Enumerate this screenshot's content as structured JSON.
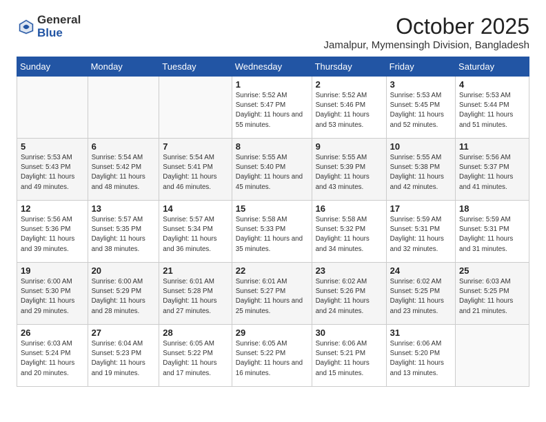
{
  "logo": {
    "general": "General",
    "blue": "Blue"
  },
  "title": "October 2025",
  "location": "Jamalpur, Mymensingh Division, Bangladesh",
  "days_of_week": [
    "Sunday",
    "Monday",
    "Tuesday",
    "Wednesday",
    "Thursday",
    "Friday",
    "Saturday"
  ],
  "weeks": [
    [
      {
        "day": "",
        "sunrise": "",
        "sunset": "",
        "daylight": ""
      },
      {
        "day": "",
        "sunrise": "",
        "sunset": "",
        "daylight": ""
      },
      {
        "day": "",
        "sunrise": "",
        "sunset": "",
        "daylight": ""
      },
      {
        "day": "1",
        "sunrise": "Sunrise: 5:52 AM",
        "sunset": "Sunset: 5:47 PM",
        "daylight": "Daylight: 11 hours and 55 minutes."
      },
      {
        "day": "2",
        "sunrise": "Sunrise: 5:52 AM",
        "sunset": "Sunset: 5:46 PM",
        "daylight": "Daylight: 11 hours and 53 minutes."
      },
      {
        "day": "3",
        "sunrise": "Sunrise: 5:53 AM",
        "sunset": "Sunset: 5:45 PM",
        "daylight": "Daylight: 11 hours and 52 minutes."
      },
      {
        "day": "4",
        "sunrise": "Sunrise: 5:53 AM",
        "sunset": "Sunset: 5:44 PM",
        "daylight": "Daylight: 11 hours and 51 minutes."
      }
    ],
    [
      {
        "day": "5",
        "sunrise": "Sunrise: 5:53 AM",
        "sunset": "Sunset: 5:43 PM",
        "daylight": "Daylight: 11 hours and 49 minutes."
      },
      {
        "day": "6",
        "sunrise": "Sunrise: 5:54 AM",
        "sunset": "Sunset: 5:42 PM",
        "daylight": "Daylight: 11 hours and 48 minutes."
      },
      {
        "day": "7",
        "sunrise": "Sunrise: 5:54 AM",
        "sunset": "Sunset: 5:41 PM",
        "daylight": "Daylight: 11 hours and 46 minutes."
      },
      {
        "day": "8",
        "sunrise": "Sunrise: 5:55 AM",
        "sunset": "Sunset: 5:40 PM",
        "daylight": "Daylight: 11 hours and 45 minutes."
      },
      {
        "day": "9",
        "sunrise": "Sunrise: 5:55 AM",
        "sunset": "Sunset: 5:39 PM",
        "daylight": "Daylight: 11 hours and 43 minutes."
      },
      {
        "day": "10",
        "sunrise": "Sunrise: 5:55 AM",
        "sunset": "Sunset: 5:38 PM",
        "daylight": "Daylight: 11 hours and 42 minutes."
      },
      {
        "day": "11",
        "sunrise": "Sunrise: 5:56 AM",
        "sunset": "Sunset: 5:37 PM",
        "daylight": "Daylight: 11 hours and 41 minutes."
      }
    ],
    [
      {
        "day": "12",
        "sunrise": "Sunrise: 5:56 AM",
        "sunset": "Sunset: 5:36 PM",
        "daylight": "Daylight: 11 hours and 39 minutes."
      },
      {
        "day": "13",
        "sunrise": "Sunrise: 5:57 AM",
        "sunset": "Sunset: 5:35 PM",
        "daylight": "Daylight: 11 hours and 38 minutes."
      },
      {
        "day": "14",
        "sunrise": "Sunrise: 5:57 AM",
        "sunset": "Sunset: 5:34 PM",
        "daylight": "Daylight: 11 hours and 36 minutes."
      },
      {
        "day": "15",
        "sunrise": "Sunrise: 5:58 AM",
        "sunset": "Sunset: 5:33 PM",
        "daylight": "Daylight: 11 hours and 35 minutes."
      },
      {
        "day": "16",
        "sunrise": "Sunrise: 5:58 AM",
        "sunset": "Sunset: 5:32 PM",
        "daylight": "Daylight: 11 hours and 34 minutes."
      },
      {
        "day": "17",
        "sunrise": "Sunrise: 5:59 AM",
        "sunset": "Sunset: 5:31 PM",
        "daylight": "Daylight: 11 hours and 32 minutes."
      },
      {
        "day": "18",
        "sunrise": "Sunrise: 5:59 AM",
        "sunset": "Sunset: 5:31 PM",
        "daylight": "Daylight: 11 hours and 31 minutes."
      }
    ],
    [
      {
        "day": "19",
        "sunrise": "Sunrise: 6:00 AM",
        "sunset": "Sunset: 5:30 PM",
        "daylight": "Daylight: 11 hours and 29 minutes."
      },
      {
        "day": "20",
        "sunrise": "Sunrise: 6:00 AM",
        "sunset": "Sunset: 5:29 PM",
        "daylight": "Daylight: 11 hours and 28 minutes."
      },
      {
        "day": "21",
        "sunrise": "Sunrise: 6:01 AM",
        "sunset": "Sunset: 5:28 PM",
        "daylight": "Daylight: 11 hours and 27 minutes."
      },
      {
        "day": "22",
        "sunrise": "Sunrise: 6:01 AM",
        "sunset": "Sunset: 5:27 PM",
        "daylight": "Daylight: 11 hours and 25 minutes."
      },
      {
        "day": "23",
        "sunrise": "Sunrise: 6:02 AM",
        "sunset": "Sunset: 5:26 PM",
        "daylight": "Daylight: 11 hours and 24 minutes."
      },
      {
        "day": "24",
        "sunrise": "Sunrise: 6:02 AM",
        "sunset": "Sunset: 5:25 PM",
        "daylight": "Daylight: 11 hours and 23 minutes."
      },
      {
        "day": "25",
        "sunrise": "Sunrise: 6:03 AM",
        "sunset": "Sunset: 5:25 PM",
        "daylight": "Daylight: 11 hours and 21 minutes."
      }
    ],
    [
      {
        "day": "26",
        "sunrise": "Sunrise: 6:03 AM",
        "sunset": "Sunset: 5:24 PM",
        "daylight": "Daylight: 11 hours and 20 minutes."
      },
      {
        "day": "27",
        "sunrise": "Sunrise: 6:04 AM",
        "sunset": "Sunset: 5:23 PM",
        "daylight": "Daylight: 11 hours and 19 minutes."
      },
      {
        "day": "28",
        "sunrise": "Sunrise: 6:05 AM",
        "sunset": "Sunset: 5:22 PM",
        "daylight": "Daylight: 11 hours and 17 minutes."
      },
      {
        "day": "29",
        "sunrise": "Sunrise: 6:05 AM",
        "sunset": "Sunset: 5:22 PM",
        "daylight": "Daylight: 11 hours and 16 minutes."
      },
      {
        "day": "30",
        "sunrise": "Sunrise: 6:06 AM",
        "sunset": "Sunset: 5:21 PM",
        "daylight": "Daylight: 11 hours and 15 minutes."
      },
      {
        "day": "31",
        "sunrise": "Sunrise: 6:06 AM",
        "sunset": "Sunset: 5:20 PM",
        "daylight": "Daylight: 11 hours and 13 minutes."
      },
      {
        "day": "",
        "sunrise": "",
        "sunset": "",
        "daylight": ""
      }
    ]
  ]
}
